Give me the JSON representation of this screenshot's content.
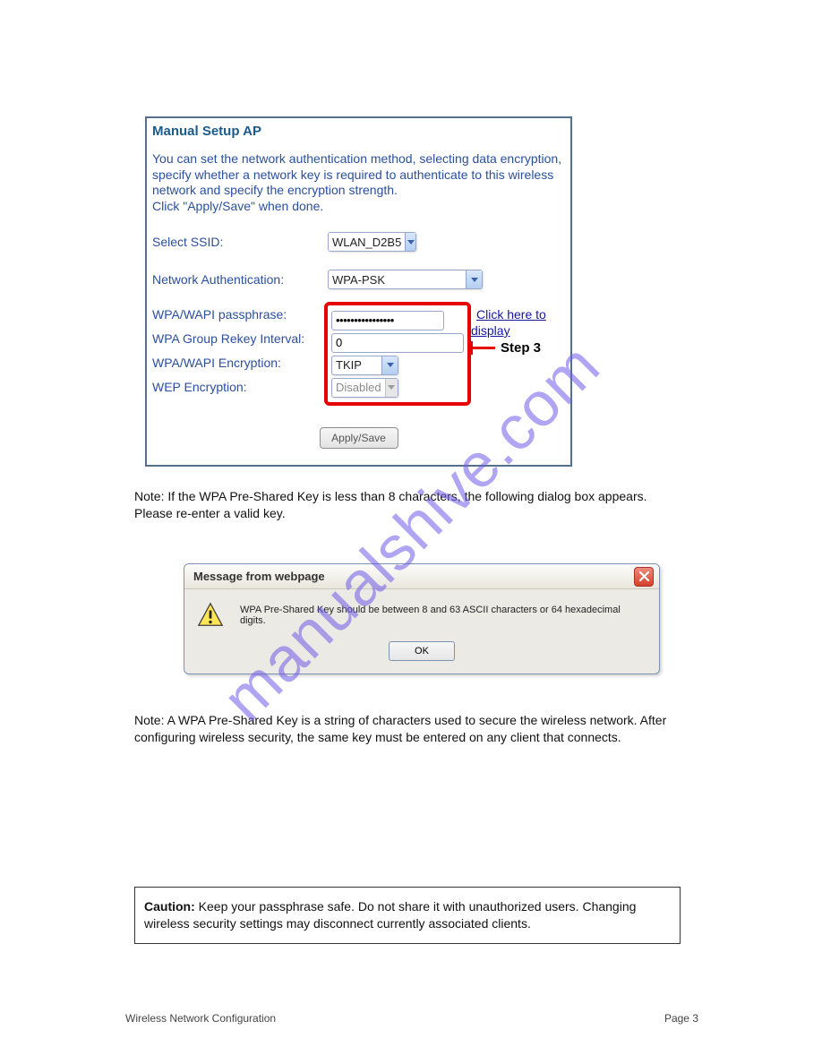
{
  "watermark": "manualshive.com",
  "panel": {
    "title": "Manual Setup AP",
    "intro": "You can set the network authentication method, selecting data encryption, specify whether a network key is required to authenticate to this wireless network and specify the encryption strength.\nClick \"Apply/Save\" when done.",
    "labels": {
      "ssid": "Select SSID:",
      "auth": "Network Authentication:",
      "pass": "WPA/WAPI passphrase:",
      "rekey": "WPA Group Rekey Interval:",
      "enc": "WPA/WAPI Encryption:",
      "wep": "WEP Encryption:"
    },
    "values": {
      "ssid": "WLAN_D2B5",
      "auth": "WPA-PSK",
      "pass": "••••••••••••••••",
      "rekey": "0",
      "enc": "TKIP",
      "wep": "Disabled"
    },
    "display_link": "Click here to display",
    "apply": "Apply/Save"
  },
  "step_label": "Step 3",
  "between_text": "Note: If the WPA Pre-Shared Key is less than 8 characters, the following dialog box appears. Please re-enter a valid key.",
  "dialog": {
    "title": "Message from webpage",
    "message": "WPA Pre-Shared Key should be between 8 and 63 ASCII characters or 64 hexadecimal digits.",
    "ok": "OK"
  },
  "after_text": "Note: A WPA Pre-Shared Key is a string of characters used to secure the wireless network. After configuring wireless security, the same key must be entered on any client that connects.",
  "caution": {
    "title": "Caution:",
    "body": "Keep your passphrase safe. Do not share it with unauthorized users. Changing wireless security settings may disconnect currently associated clients."
  },
  "footer": {
    "left": "Wireless Network Configuration",
    "right": "Page 3"
  }
}
